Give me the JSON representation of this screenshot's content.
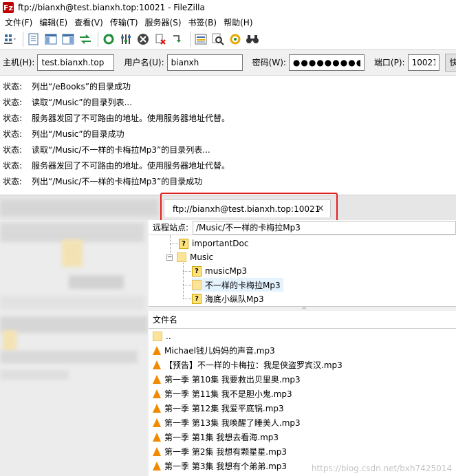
{
  "window": {
    "title": "ftp://bianxh@test.bianxh.top:10021 - FileZilla",
    "app_icon": "Fz"
  },
  "menu": [
    "文件(F)",
    "编辑(E)",
    "查看(V)",
    "传输(T)",
    "服务器(S)",
    "书签(B)",
    "帮助(H)"
  ],
  "toolbar_icons": [
    "site-manager-icon",
    "toggle-log-icon",
    "toggle-local-tree-icon",
    "toggle-remote-tree-icon",
    "toggle-queue-icon",
    "refresh-icon",
    "process-queue-icon",
    "cancel-icon",
    "disconnect-icon",
    "reconnect-icon",
    "directory-listing-filter-icon",
    "compare-directories-icon",
    "sync-browsing-icon",
    "search-icon"
  ],
  "quickconnect": {
    "host_label": "主机(H):",
    "host_value": "test.bianxh.top",
    "user_label": "用户名(U):",
    "user_value": "bianxh",
    "pass_label": "密码(W):",
    "pass_value": "●●●●●●●●●●",
    "port_label": "端口(P):",
    "port_value": "10021",
    "connect_label": "快"
  },
  "log": [
    {
      "status": "状态:",
      "message": "列出“/eBooks”的目录成功"
    },
    {
      "status": "状态:",
      "message": "读取“/Music”的目录列表..."
    },
    {
      "status": "状态:",
      "message": "服务器发回了不可路由的地址。使用服务器地址代替。"
    },
    {
      "status": "状态:",
      "message": "列出“/Music”的目录成功"
    },
    {
      "status": "状态:",
      "message": "读取“/Music/不一样的卡梅拉Mp3”的目录列表..."
    },
    {
      "status": "状态:",
      "message": "服务器发回了不可路由的地址。使用服务器地址代替。"
    },
    {
      "status": "状态:",
      "message": "列出“/Music/不一样的卡梅拉Mp3”的目录成功"
    }
  ],
  "tab": {
    "label": "ftp://bianxh@test.bianxh.top:10021",
    "close": "×"
  },
  "remote": {
    "site_label": "远程站点:",
    "path": "/Music/不一样的卡梅拉Mp3",
    "tree": [
      {
        "name": "importantDoc",
        "type": "unknown"
      },
      {
        "name": "Music",
        "type": "folder",
        "expander": "−"
      },
      {
        "name": "musicMp3",
        "type": "unknown"
      },
      {
        "name": "不一样的卡梅拉Mp3",
        "type": "folder-selected"
      },
      {
        "name": "海底小纵队Mp3",
        "type": "unknown"
      }
    ],
    "list_header": "文件名",
    "parent_dir": "..",
    "files": [
      "Michael钱儿妈妈的声音.mp3",
      "【预告】不一样的卡梅拉：我是侠盗罗宾汉.mp3",
      "第一季 第10集 我要救出贝里奥.mp3",
      "第一季 第11集 我不是胆小鬼.mp3",
      "第一季 第12集 我爱平底锅.mp3",
      "第一季 第13集 我唤醒了睡美人.mp3",
      "第一季 第1集 我想去看海.mp3",
      "第一季 第2集 我想有颗星星.mp3",
      "第一季 第3集 我想有个弟弟.mp3"
    ]
  },
  "watermark": "https://blog.csdn.net/bxh7425014"
}
